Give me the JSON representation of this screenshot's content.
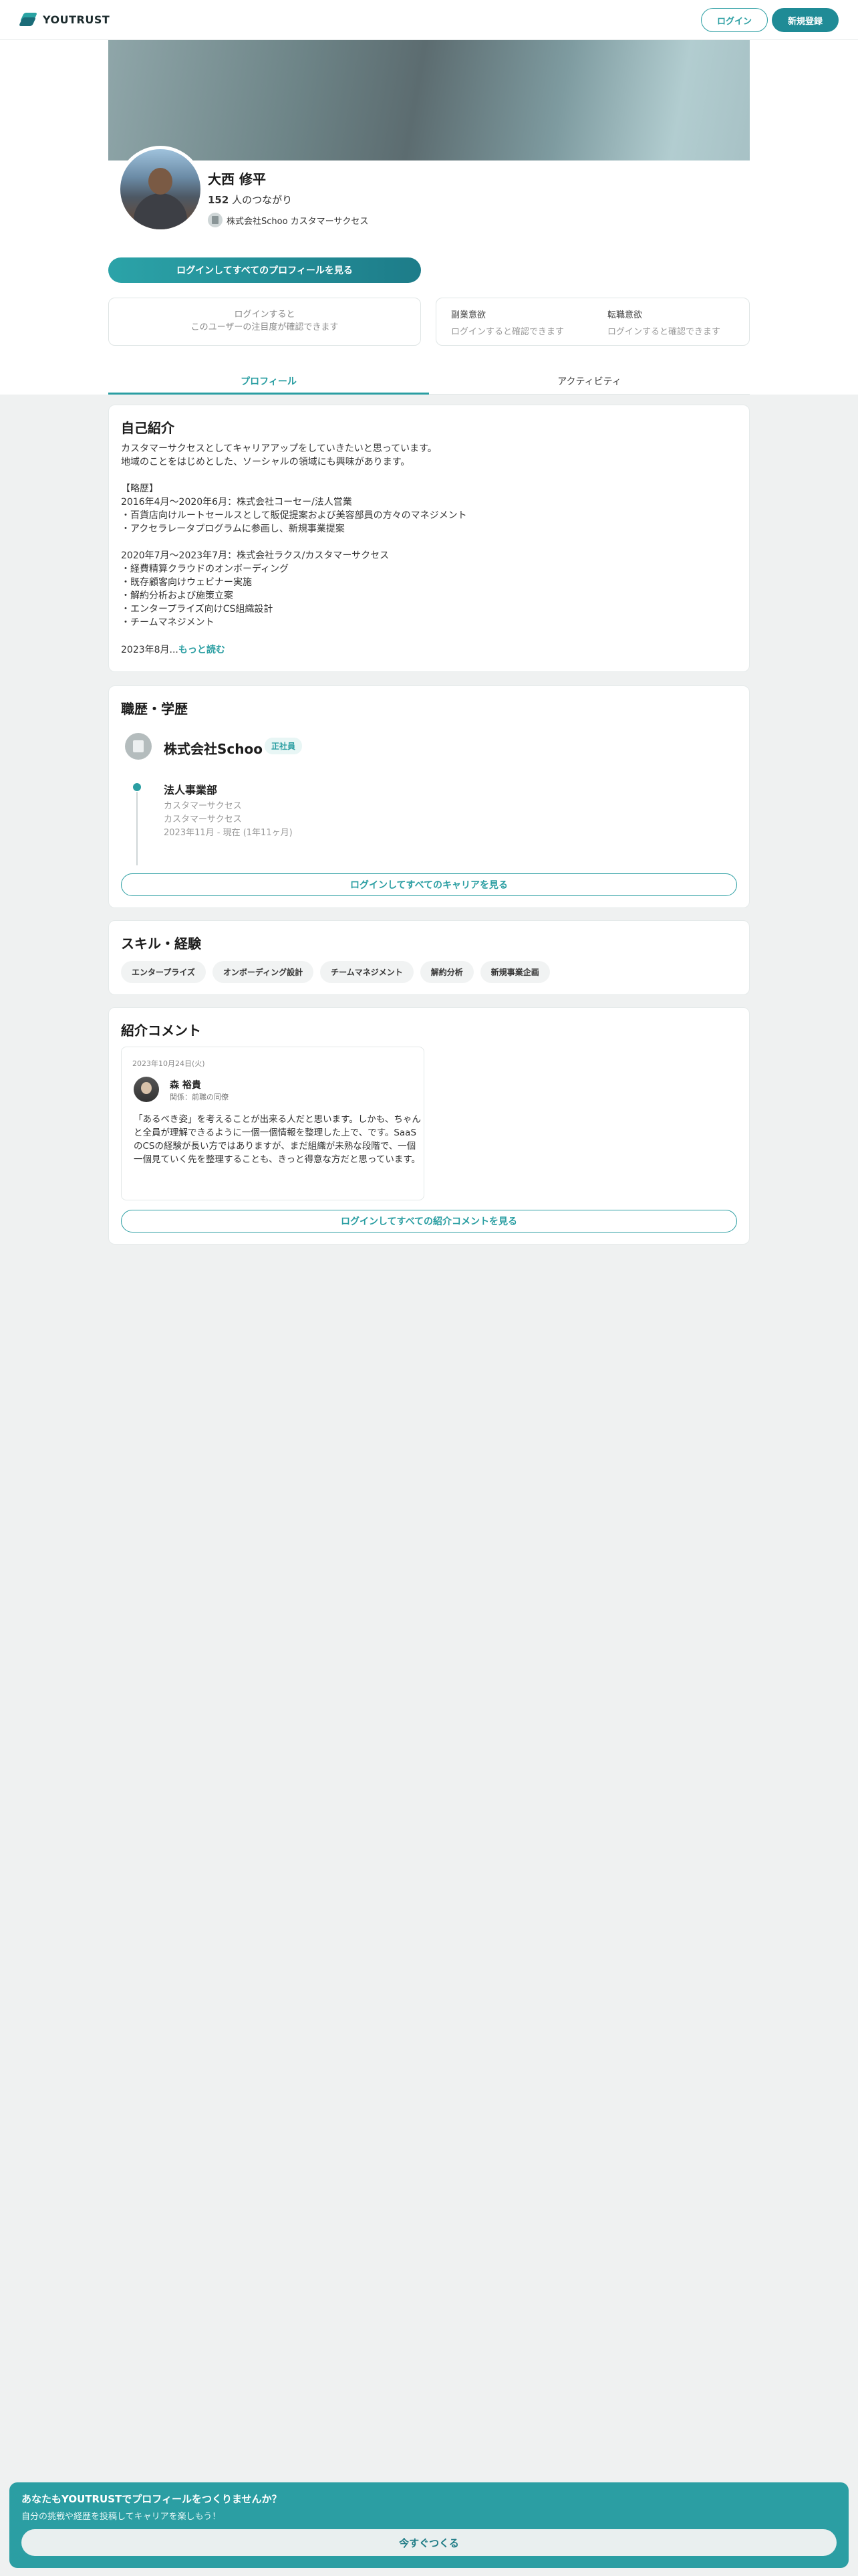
{
  "header": {
    "logo_text": "YOUTRUST",
    "login_label": "ログイン",
    "signup_label": "新規登録"
  },
  "profile": {
    "name": "大西 修平",
    "connections_count": "152",
    "connections_suffix": "人のつながり",
    "company_role": "株式会社Schoo カスタマーサクセス",
    "view_all_label": "ログインしてすべてのプロフィールを見る",
    "attention_line1": "ログインすると",
    "attention_line2": "このユーザーの注目度が確認できます",
    "side_job_title": "副業意欲",
    "side_job_value": "ログインすると確認できます",
    "job_change_title": "転職意欲",
    "job_change_value": "ログインすると確認できます"
  },
  "tabs": [
    {
      "label": "プロフィール"
    },
    {
      "label": "アクティビティ"
    }
  ],
  "intro": {
    "title": "自己紹介",
    "text": "カスタマーサクセスとしてキャリアアップをしていきたいと思っています。\n地域のことをはじめとした、ソーシャルの領域にも興味があります。\n\n【略歴】\n2016年4月〜2020年6月：株式会社コーセー/法人営業\n・百貨店向けルートセールスとして販促提案および美容部員の方々のマネジメント\n・アクセラレータプログラムに参画し、新規事業提案\n\n2020年7月〜2023年7月：株式会社ラクス/カスタマーサクセス\n・経費精算クラウドのオンボーディング\n・既存顧客向けウェビナー実施\n・解約分析および施策立案\n・エンタープライズ向けCS組織設計\n・チームマネジメント",
    "truncated": "2023年8月...",
    "more_label": "もっと読む"
  },
  "career": {
    "title": "職歴・学歴",
    "company": "株式会社Schoo",
    "badge": "正社員",
    "role_title": "法人事業部",
    "role_sub1": "カスタマーサクセス",
    "role_sub2": "カスタマーサクセス",
    "period": "2023年11月 - 現在 (1年11ヶ月)",
    "view_all_label": "ログインしてすべてのキャリアを見る"
  },
  "skills": {
    "title": "スキル・経験",
    "items": [
      "エンタープライズ",
      "オンボーディング設計",
      "チームマネジメント",
      "解約分析",
      "新規事業企画"
    ]
  },
  "comments": {
    "title": "紹介コメント",
    "date": "2023年10月24日(火)",
    "author": "森 裕貴",
    "relation": "関係：前職の同僚",
    "text": "「あるべき姿」を考えることが出来る人だと思います。しかも、ちゃんと全員が理解できるように一個一個情報を整理した上で、です。SaaSのCSの経験が長い方ではありますが、まだ組織が未熟な段階で、一個一個見ていく先を整理することも、きっと得意な方だと思っています。",
    "view_all_label": "ログインしてすべての紹介コメントを見る"
  },
  "cta": {
    "title": "あなたもYOUTRUSTでプロフィールをつくりませんか？",
    "subtitle": "自分の挑戦や経歴を投稿してキャリアを楽しもう！",
    "button_label": "今すぐつくる"
  }
}
